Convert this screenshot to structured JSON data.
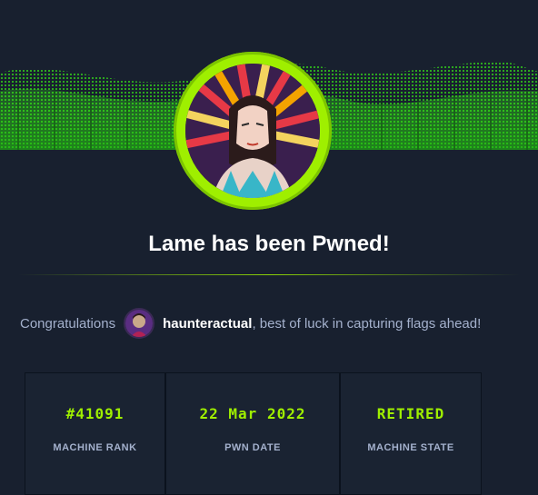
{
  "page": {
    "title": "Lame has been Pwned!",
    "accent_color": "#9fef00",
    "background_color": "#18202f"
  },
  "congrats": {
    "prefix": "Congratulations",
    "username": "haunteractual",
    "suffix": ", best of luck in capturing flags ahead!"
  },
  "stats": [
    {
      "value": "#41091",
      "label": "MACHINE RANK"
    },
    {
      "value": "22 Mar 2022",
      "label": "PWN DATE"
    },
    {
      "value": "RETIRED",
      "label": "MACHINE STATE"
    }
  ],
  "icons": {
    "machine_avatar": "machine-avatar-icon",
    "user_avatar": "user-avatar-icon"
  }
}
